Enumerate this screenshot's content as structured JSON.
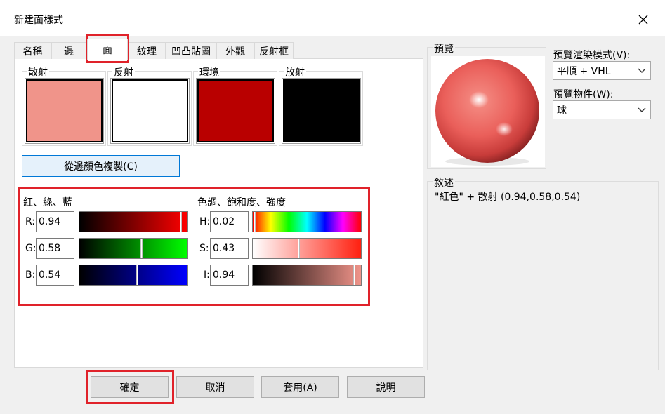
{
  "window": {
    "title": "新建面樣式"
  },
  "tabs": [
    {
      "label": "名稱"
    },
    {
      "label": "邊"
    },
    {
      "label": "面"
    },
    {
      "label": "紋理"
    },
    {
      "label": "凹凸貼圖"
    },
    {
      "label": "外觀"
    },
    {
      "label": "反射框"
    }
  ],
  "swatches": {
    "diffuse": {
      "label": "散射",
      "color": "#f0948a"
    },
    "reflect": {
      "label": "反射",
      "color": "#ffffff"
    },
    "ambient": {
      "label": "環境",
      "color": "#b90000"
    },
    "emit": {
      "label": "放射",
      "color": "#000000"
    }
  },
  "copy_button": "從邊顏色複製(C)",
  "rgb": {
    "title": "紅、綠、藍",
    "r": {
      "label": "R:",
      "value": "0.94"
    },
    "g": {
      "label": "G:",
      "value": "0.58"
    },
    "b": {
      "label": "B:",
      "value": "0.54"
    }
  },
  "hsi": {
    "title": "色調、飽和度、強度",
    "h": {
      "label": "H:",
      "value": "0.02"
    },
    "s": {
      "label": "S:",
      "value": "0.43"
    },
    "i": {
      "label": "I:",
      "value": "0.94"
    }
  },
  "preview": {
    "title": "預覽",
    "render_mode_label": "預覽渲染模式(V):",
    "render_mode_value": "平順 + VHL",
    "object_label": "預覽物件(W):",
    "object_value": "球"
  },
  "description": {
    "title": "敘述",
    "text": "\"紅色\" + 散射 (0.94,0.58,0.54)"
  },
  "footer": {
    "ok": "確定",
    "cancel": "取消",
    "apply": "套用(A)",
    "help": "說明"
  },
  "colors": {
    "highlight": "#e0222a",
    "sphere": "#ef6b66"
  }
}
